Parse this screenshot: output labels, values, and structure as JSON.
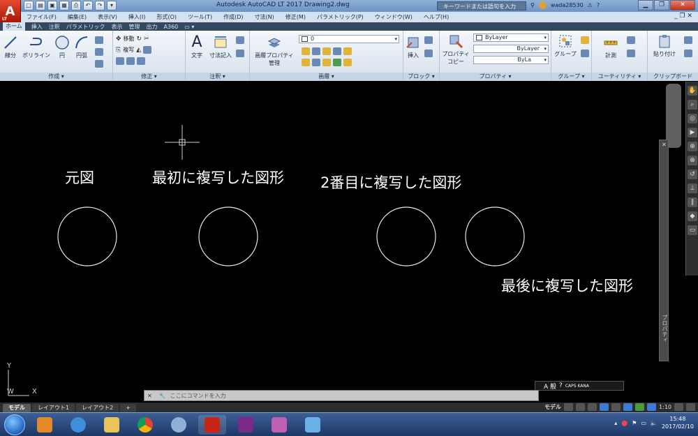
{
  "titlebar": {
    "app_letter": "A",
    "app_sub": "LT",
    "title": "Autodesk AutoCAD LT 2017    Drawing2.dwg",
    "search_placeholder": "キーワードまたは語句を入力",
    "username": "wada28530",
    "min": "▁",
    "max": "❐",
    "close": "✕"
  },
  "menubar": {
    "items": [
      "ファイル(F)",
      "編集(E)",
      "表示(V)",
      "挿入(I)",
      "形式(O)",
      "ツール(T)",
      "作成(D)",
      "寸法(N)",
      "修正(M)",
      "パラメトリック(P)",
      "ウィンドウ(W)",
      "ヘルプ(H)"
    ],
    "right": "_ ❐ ✕"
  },
  "tabs": [
    "ホーム",
    "挿入",
    "注釈",
    "パラメトリック",
    "表示",
    "管理",
    "出力",
    "A360",
    "▭ ▾"
  ],
  "ribbon": {
    "draw": {
      "label": "作成 ▾",
      "line": "線分",
      "polyline": "ポリライン",
      "circle": "円",
      "arc": "円弧"
    },
    "modify": {
      "label": "修正 ▾",
      "move": "移動",
      "copy": "複写"
    },
    "annotation": {
      "label": "注釈 ▾",
      "text": "文字",
      "dimension": "寸法記入"
    },
    "layers": {
      "label": "画層 ▾",
      "layer_props": "画層プロパティ",
      "layer_props2": "管理",
      "layer_value": "0"
    },
    "block": {
      "label": "ブロック ▾",
      "insert": "挿入"
    },
    "properties": {
      "label": "プロパティ ▾",
      "match": "プロパティ",
      "match2": "コピー",
      "bylayer1": "ByLayer",
      "bylayer2": "ByLayer",
      "bylayer3": "ByLa"
    },
    "groups": {
      "label": "グループ ▾",
      "group": "グループ"
    },
    "utilities": {
      "label": "ユーティリティ ▾",
      "measure": "計測"
    },
    "clipboard": {
      "label": "クリップボード",
      "paste": "貼り付け"
    }
  },
  "canvas": {
    "captions": {
      "original": "元図",
      "first_copy": "最初に複写した図形",
      "second_copy": "2番目に複写した図形",
      "last_copy": "最後に複写した図形"
    },
    "ucs": {
      "x": "X",
      "y": "Y",
      "w": "W"
    }
  },
  "props_palette": {
    "title": "プロパティ",
    "close": "✕"
  },
  "cmdline": {
    "close": "✕",
    "wrench": "🔧",
    "placeholder": "ここにコマンドを入力"
  },
  "ime": {
    "text": "A 般",
    "caps": "CAPS KANA"
  },
  "layout_tabs": [
    "モデル",
    "レイアウト1",
    "レイアウト2",
    "+"
  ],
  "status": {
    "model": "モデル",
    "scale": "1:10"
  },
  "taskbar": {
    "time": "15:48",
    "date": "2017/02/10"
  }
}
